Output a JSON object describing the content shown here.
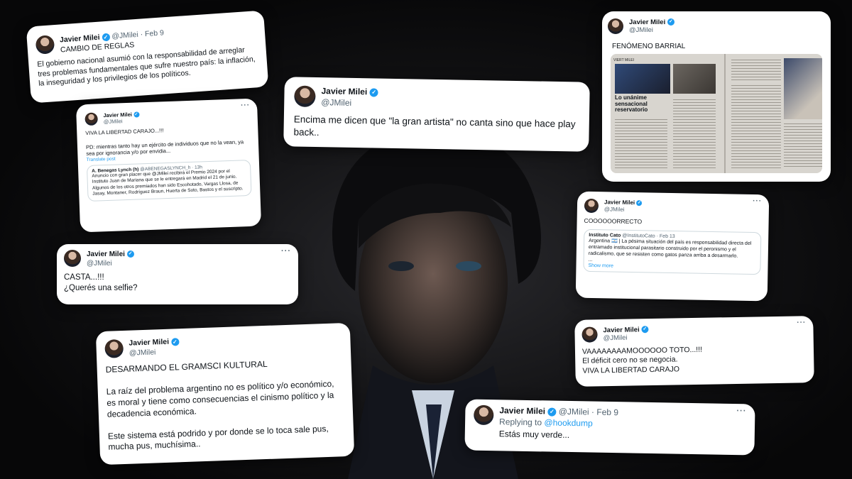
{
  "tweets": {
    "t1": {
      "name": "Javier Milei",
      "handle": "@JMilei",
      "date": "· Feb 9",
      "title": "CAMBIO DE REGLAS",
      "text": "El gobierno nacional asumió con la responsabilidad de arreglar tres problemas fundamentales que sufre nuestro país: la inflación, la inseguridad y los privilegios de los políticos."
    },
    "t2": {
      "name": "Javier Milei",
      "handle": "@JMilei",
      "text": "VIVA LA LIBERTAD CARAJO...!!!\n\nPD: mientras tanto hay un ejército de individuos que no la vean, ya sea por ignorancia y/o por envidia...",
      "translate": "Translate post",
      "quote": {
        "name": "A. Benegas Lynch (h)",
        "handle": "@ABENEGASLYNCH_h · 13h",
        "text": "Anuncio con gran placer que @JMilei recibirá el Premio 2024 por el Instituto Juan de Mariana que se le entregará en Madrid el 21 de junio. Algunos de los otros premiados han sido Escohotado, Vargas Llosa, de Jasay, Montaner, Rodríguez Braun, Huerta de Soto, Bastos y el suscripto."
      }
    },
    "t3": {
      "name": "Javier Milei",
      "handle": "@JMilei",
      "text": "CASTA...!!!\n¿Querés una selfie?"
    },
    "t4": {
      "name": "Javier Milei",
      "handle": "@JMilei",
      "text": "DESARMANDO EL GRAMSCI KULTURAL\n\nLa raíz del problema argentino no es político y/o económico, es moral y tiene como consecuencias el cinismo político y la decadencia económica.\n\nEste sistema está podrido y por donde se lo toca sale pus, mucha pus, muchísima.."
    },
    "t5": {
      "name": "Javier Milei",
      "handle": "@JMilei",
      "text": "Encima me dicen que \"la gran artista\" no canta sino que hace play back.."
    },
    "t6": {
      "name": "Javier Milei",
      "handle": "@JMilei",
      "text": "FENÓMENO BARRIAL",
      "image_caption": "VIERT MILEI",
      "headline": "Lo unánime\nsensacional\nreservatorio"
    },
    "t7": {
      "name": "Javier Milei",
      "handle": "@JMilei",
      "text": "COOOOOORRECTO",
      "show_more": "Show more",
      "quote": {
        "name": "Instituto Cato",
        "handle": "@InstitutoCato · Feb 13",
        "text": "Argentina 🇦🇷 | La pésima situación del país es responsabilidad directa del entramado institucional parasitario construido por el peronismo y el radicalismo, que se resisten como gatos panza arriba a desarmarlo.\n..."
      }
    },
    "t8": {
      "name": "Javier Milei",
      "handle": "@JMilei",
      "text": "VAAAAAAAAMOOOOOO TOTO...!!!\nEl déficit cero no se negocia.\nVIVA LA LIBERTAD CARAJO"
    },
    "t9": {
      "name": "Javier Milei",
      "handle": "@JMilei",
      "date": "· Feb 9",
      "replying": "Replying to",
      "reply_to": "@hookdump",
      "text": "Estás muy verde..."
    }
  },
  "icons": {
    "verified": "verified-badge-icon",
    "more": "more-dots-icon"
  },
  "colors": {
    "verified": "#1d9bf0",
    "background": "#0a0a0a"
  }
}
